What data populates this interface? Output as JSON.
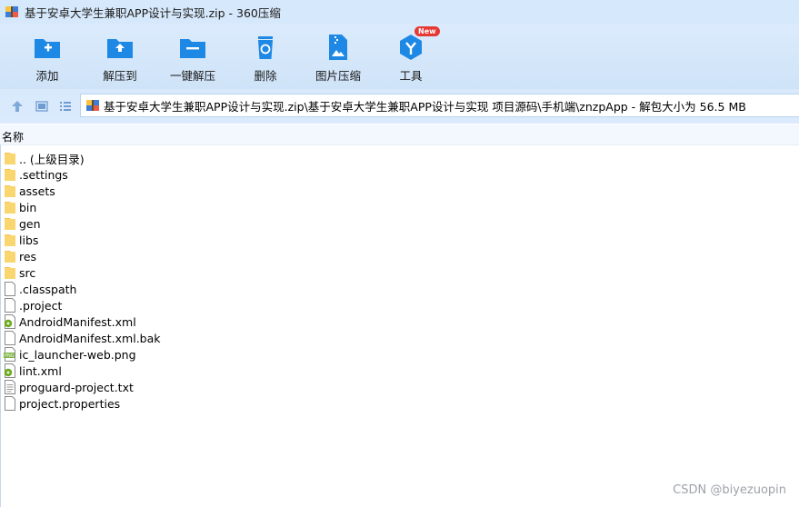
{
  "window": {
    "title": "基于安卓大学生兼职APP设计与实现.zip - 360压缩",
    "app_icon": "archive-app-icon"
  },
  "toolbar": {
    "buttons": [
      {
        "label": "添加",
        "icon": "folder-add-icon"
      },
      {
        "label": "解压到",
        "icon": "folder-extract-icon"
      },
      {
        "label": "一键解压",
        "icon": "folder-minus-icon"
      },
      {
        "label": "删除",
        "icon": "trash-icon"
      },
      {
        "label": "图片压缩",
        "icon": "image-compress-icon"
      },
      {
        "label": "工具",
        "icon": "tools-icon",
        "badge": "New"
      }
    ]
  },
  "nav": {
    "path": "基于安卓大学生兼职APP设计与实现.zip\\基于安卓大学生兼职APP设计与实现 项目源码\\手机端\\znzpApp - 解包大小为 56.5 MB"
  },
  "list": {
    "column_name": "名称",
    "items": [
      {
        "name": ".. (上级目录)",
        "type": "folder"
      },
      {
        "name": ".settings",
        "type": "folder"
      },
      {
        "name": "assets",
        "type": "folder"
      },
      {
        "name": "bin",
        "type": "folder"
      },
      {
        "name": "gen",
        "type": "folder"
      },
      {
        "name": "libs",
        "type": "folder"
      },
      {
        "name": "res",
        "type": "folder"
      },
      {
        "name": "src",
        "type": "folder"
      },
      {
        "name": ".classpath",
        "type": "file"
      },
      {
        "name": ".project",
        "type": "file"
      },
      {
        "name": "AndroidManifest.xml",
        "type": "xml"
      },
      {
        "name": "AndroidManifest.xml.bak",
        "type": "file"
      },
      {
        "name": "ic_launcher-web.png",
        "type": "png"
      },
      {
        "name": "lint.xml",
        "type": "xml"
      },
      {
        "name": "proguard-project.txt",
        "type": "txt"
      },
      {
        "name": "project.properties",
        "type": "file"
      }
    ]
  },
  "watermark": "CSDN @biyezuopin",
  "colors": {
    "accent": "#1e88e5",
    "folder": "#f9d66f",
    "toolbar_bg": "#d6e8fb"
  }
}
